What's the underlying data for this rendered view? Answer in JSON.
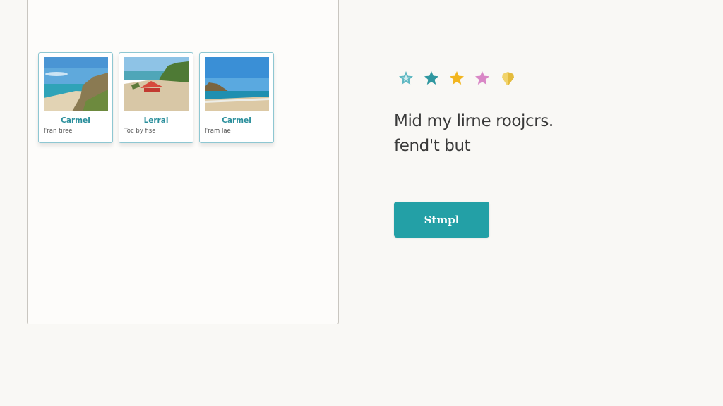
{
  "cards": [
    {
      "title": "Carmei",
      "subtitle": "Fran tiree",
      "photo": "beach-coast-photo"
    },
    {
      "title": "Lerral",
      "subtitle": "Toc by fise",
      "photo": "beach-umbrella-photo"
    },
    {
      "title": "Carmel",
      "subtitle": "Fram lae",
      "photo": "rocky-shore-photo"
    }
  ],
  "rating": {
    "icons": [
      "teal-star-icon",
      "teal-star-icon",
      "yellow-star-icon",
      "pink-star-icon",
      "yellow-gem-icon"
    ],
    "colors": [
      "#5fb8c2",
      "#2f97a0",
      "#f2b51e",
      "#d987c6",
      "#f1d36a"
    ]
  },
  "message": {
    "line1": "Mid my lirne roojcrs.",
    "line2": "fend't but"
  },
  "action_button": {
    "label": "Stmpl",
    "color": "#23a0a6"
  }
}
